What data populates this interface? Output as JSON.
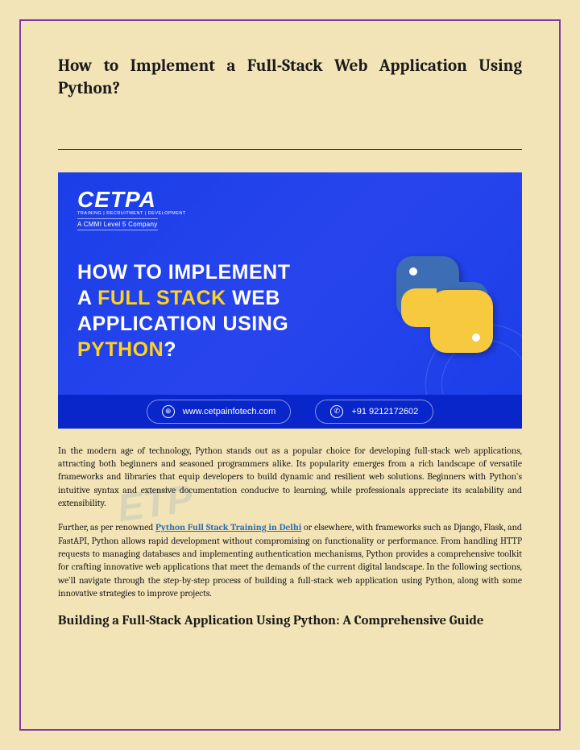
{
  "title": "How to Implement a Full-Stack Web Application Using Python?",
  "banner": {
    "logo_main": "CETPA",
    "logo_sub1": "TRAINING | RECRUITMENT | DEVELOPMENT",
    "logo_sub2": "A CMMI Level 5 Company",
    "headline_line1": "HOW TO IMPLEMENT",
    "headline_a": "A ",
    "headline_fullstack": "FULL STACK",
    "headline_web": " WEB",
    "headline_line3": "APPLICATION USING",
    "headline_python": "PYTHON",
    "headline_q": "?",
    "website": "www.cetpainfotech.com",
    "phone": "+91 9212172602"
  },
  "watermark": "ETP",
  "paragraph1": "In the modern age of technology, Python stands out as a popular choice for developing full-stack web applications, attracting both beginners and seasoned programmers alike. Its popularity emerges from a rich landscape of versatile frameworks and libraries that equip developers to build dynamic and resilient web solutions. Beginners with Python's intuitive syntax and extensive documentation conducive to learning, while professionals appreciate its scalability and extensibility.",
  "paragraph2_pre": "Further, as per renowned ",
  "paragraph2_link": "Python Full Stack Training in Delhi",
  "paragraph2_post": " or elsewhere, with frameworks such as Django, Flask, and FastAPI, Python allows rapid development without compromising on functionality or performance. From handling HTTP requests to managing databases and implementing authentication mechanisms, Python provides a comprehensive toolkit for crafting innovative web applications that meet the demands of the current digital landscape. In the following sections, we'll navigate through the step-by-step process of building a full-stack web application using Python, along with some innovative strategies to improve projects.",
  "subheading": "Building a Full-Stack Application Using Python: A Comprehensive Guide"
}
